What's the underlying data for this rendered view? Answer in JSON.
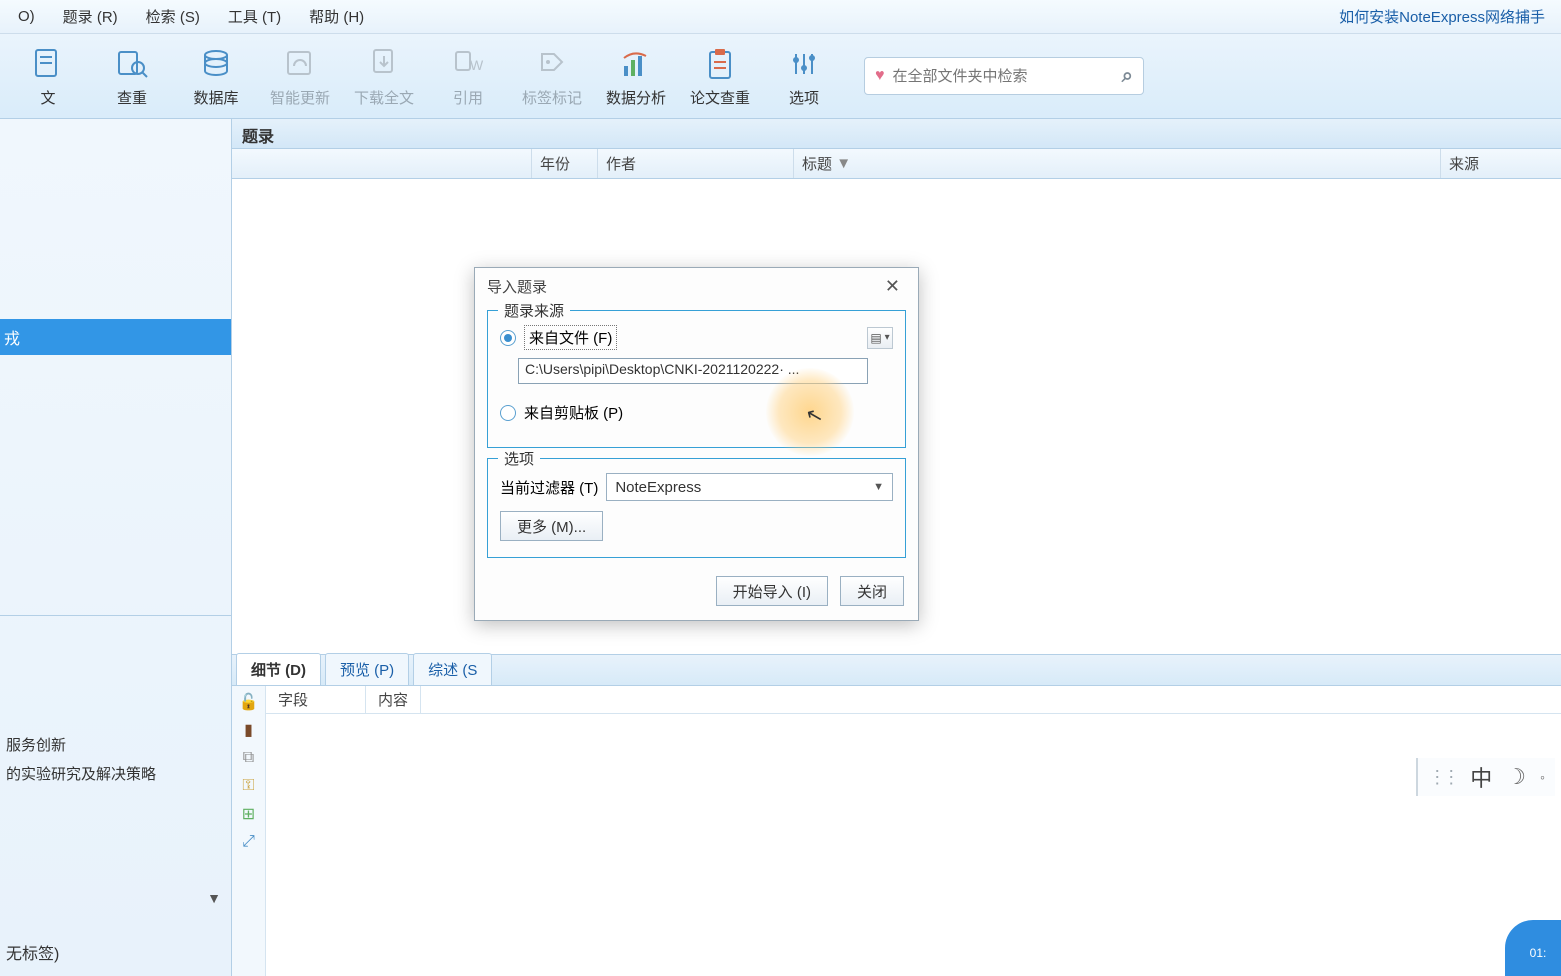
{
  "menu": {
    "items": [
      "O)",
      "题录 (R)",
      "检索 (S)",
      "工具 (T)",
      "帮助 (H)"
    ],
    "helpLink": "如何安装NoteExpress网络捕手"
  },
  "toolbar": {
    "buttons": [
      {
        "label": "文",
        "icon": "doc"
      },
      {
        "label": "查重",
        "icon": "magnify-doc"
      },
      {
        "label": "数据库",
        "icon": "database"
      },
      {
        "label": "智能更新",
        "icon": "update",
        "disabled": true
      },
      {
        "label": "下载全文",
        "icon": "download",
        "disabled": true
      },
      {
        "label": "引用",
        "icon": "quote",
        "disabled": true
      },
      {
        "label": "标签标记",
        "icon": "tag",
        "disabled": true
      },
      {
        "label": "数据分析",
        "icon": "chart"
      },
      {
        "label": "论文查重",
        "icon": "clipboard"
      },
      {
        "label": "选项",
        "icon": "sliders"
      }
    ],
    "searchPlaceholder": "在全部文件夹中检索"
  },
  "leftPanel": {
    "selected": "戎",
    "lines": [
      "服务创新",
      "的实验研究及解决策略"
    ],
    "tag": "无标签)"
  },
  "rightPanel": {
    "title": "题录",
    "columns": {
      "year": "年份",
      "author": "作者",
      "title": "标题",
      "source": "来源"
    },
    "tabs": {
      "detail": "细节 (D)",
      "preview": "预览 (P)",
      "summary": "综述 (S"
    },
    "detailCols": {
      "field": "字段",
      "content": "内容"
    }
  },
  "dialog": {
    "title": "导入题录",
    "group1": {
      "legend": "题录来源",
      "fromFile": "来自文件 (F)",
      "filePath": "C:\\Users\\pipi\\Desktop\\CNKI-2021120222· ...",
      "fromClipboard": "来自剪贴板 (P)"
    },
    "group2": {
      "legend": "选项",
      "filterLabel": "当前过滤器 (T)",
      "filterValue": "NoteExpress",
      "moreBtn": "更多 (M)..."
    },
    "buttons": {
      "start": "开始导入 (I)",
      "close": "关闭"
    }
  },
  "ime": {
    "lang": "中"
  },
  "timestamp": "01:"
}
